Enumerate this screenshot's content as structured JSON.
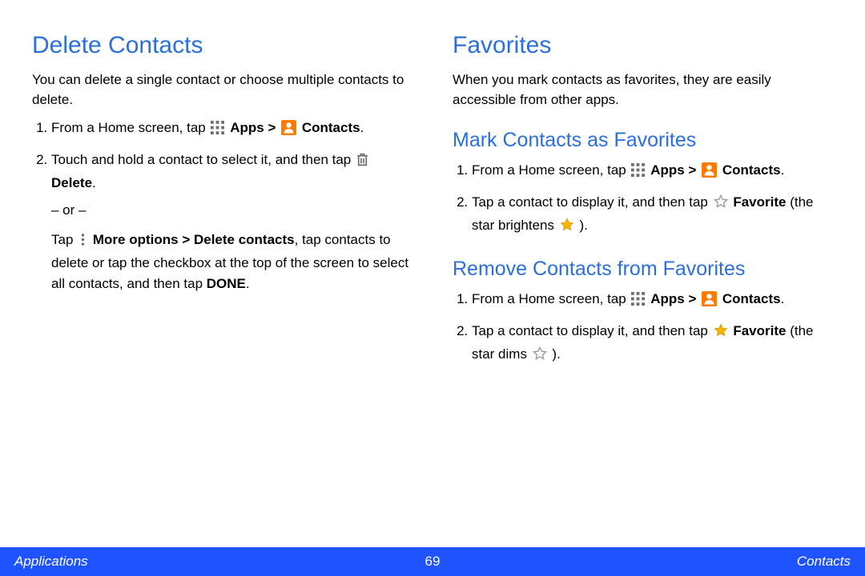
{
  "left": {
    "heading": "Delete Contacts",
    "intro": "You can delete a single contact or choose multiple contacts to delete.",
    "step1_prefix": "From a Home screen, tap ",
    "apps_label": "Apps",
    "gt": " > ",
    "contacts_label": "Contacts",
    "step2_p1": "Touch and hold a contact to select it, and then tap ",
    "delete_label": "Delete",
    "or_text": "– or –",
    "step2_p2a": "Tap ",
    "more_options_label": "More options > Delete contacts",
    "step2_p2b": ", tap contacts to delete or tap the checkbox at the top of the screen to select all contacts, and then tap ",
    "done_label": "DONE",
    "period": "."
  },
  "right": {
    "heading_main": "Favorites",
    "intro_main": "When you mark contacts as favorites, they are easily accessible from other apps.",
    "heading_mark": "Mark Contacts as Favorites",
    "mark_step1_prefix": "From a Home screen, tap ",
    "mark_step2_a": "Tap a contact to display it, and then tap ",
    "favorite_label": "Favorite",
    "mark_step2_b": " (the star brightens ",
    "mark_step2_c": " ).",
    "heading_remove": "Remove Contacts from Favorites",
    "remove_step2_b": " (the star dims ",
    "remove_step2_c": " )."
  },
  "footer": {
    "left": "Applications",
    "page": "69",
    "right": "Contacts"
  }
}
